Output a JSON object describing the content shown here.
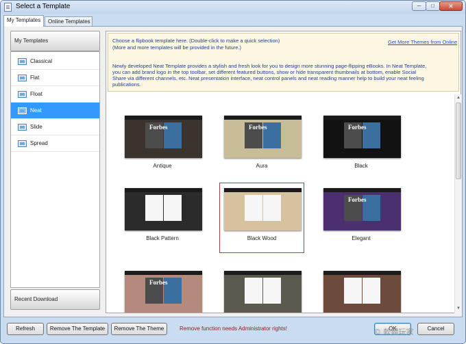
{
  "window": {
    "title": "Select a Template",
    "controls": {
      "minimize": "─",
      "maximize": "□",
      "close": "✕"
    }
  },
  "tabs": [
    {
      "label": "My Templates",
      "active": true
    },
    {
      "label": "Online Templates",
      "active": false
    }
  ],
  "sidebar": {
    "header": "My Templates",
    "items": [
      {
        "label": "Classical",
        "icon": "template-icon"
      },
      {
        "label": "Flat",
        "icon": "template-icon"
      },
      {
        "label": "Float",
        "icon": "template-icon"
      },
      {
        "label": "Neat",
        "icon": "template-icon",
        "selected": true
      },
      {
        "label": "Slide",
        "icon": "template-icon"
      },
      {
        "label": "Spread",
        "icon": "template-icon"
      }
    ],
    "footer": "Recent Download"
  },
  "info": {
    "line1": "Choose a flipbook template here. (Double-click to make a quick selection)",
    "line2": "(More and more templates will be provided in the future.)",
    "link": "Get More Themes from Online",
    "desc": [
      "Newly developed Neat Template provides a stylish and fresh look for you to design more stunning page-flipping eBooks. In Neat Template,",
      "you can add brand logo in the top toolbar, set different featured buttons, show or hide transparent thumbnails at bottom, enable Social",
      "Share via different channels, etc. Neat presentation interface, neat control panels and neat reading manner help to build your neat feeling",
      "publications."
    ]
  },
  "templates": [
    {
      "name": "Antique",
      "cover_text": "Forbes",
      "selected": false
    },
    {
      "name": "Aura",
      "cover_text": "Forbes",
      "selected": false
    },
    {
      "name": "Black",
      "cover_text": "Forbes",
      "selected": false
    },
    {
      "name": "Black Pattern",
      "cover_text": "",
      "selected": false
    },
    {
      "name": "Black Wood",
      "cover_text": "",
      "selected": true
    },
    {
      "name": "Elegant",
      "cover_text": "Forbes",
      "selected": false
    },
    {
      "name": "",
      "cover_text": "Forbes",
      "selected": false
    },
    {
      "name": "",
      "cover_text": "",
      "selected": false
    },
    {
      "name": "",
      "cover_text": "",
      "selected": false
    }
  ],
  "footer": {
    "refresh": "Refresh",
    "remove_template": "Remove The Template",
    "remove_theme": "Remove The Theme",
    "admin_note": "Remove function needs Administrator rights!",
    "ok": "OK",
    "cancel": "Cancel"
  },
  "watermark": "© 軟體玩家",
  "scrollbar": {
    "up": "▲",
    "down": "▼"
  }
}
